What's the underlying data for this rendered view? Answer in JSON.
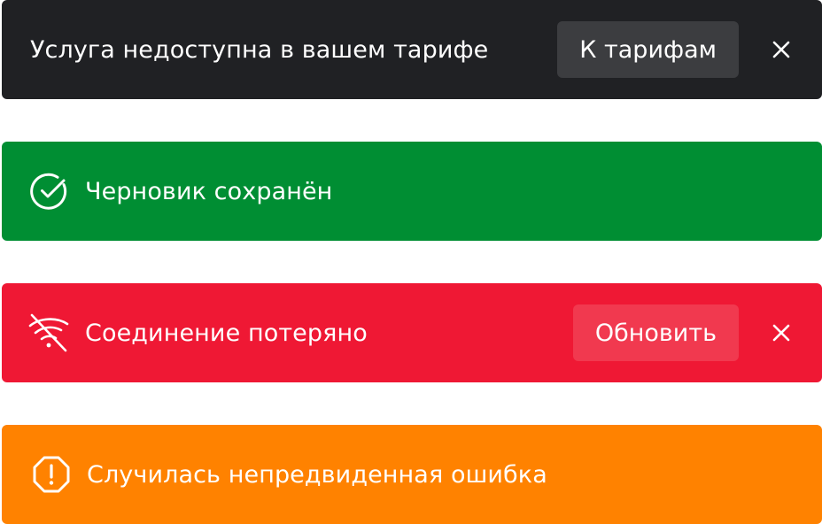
{
  "toasts": [
    {
      "variant": "neutral",
      "background": "#202124",
      "message": "Услуга недоступна в вашем тарифе",
      "action_label": "К тарифам",
      "close_icon": "close-icon"
    },
    {
      "variant": "success",
      "background": "#008e33",
      "icon": "check-circle-icon",
      "message": "Черновик сохранён"
    },
    {
      "variant": "error",
      "background": "#ef1834",
      "icon": "wifi-off-icon",
      "message": "Соединение потеряно",
      "action_label": "Обновить",
      "close_icon": "close-icon"
    },
    {
      "variant": "warning",
      "background": "#ff8200",
      "icon": "octagon-alert-icon",
      "message": "Случилась непредвиденная ошибка"
    }
  ]
}
